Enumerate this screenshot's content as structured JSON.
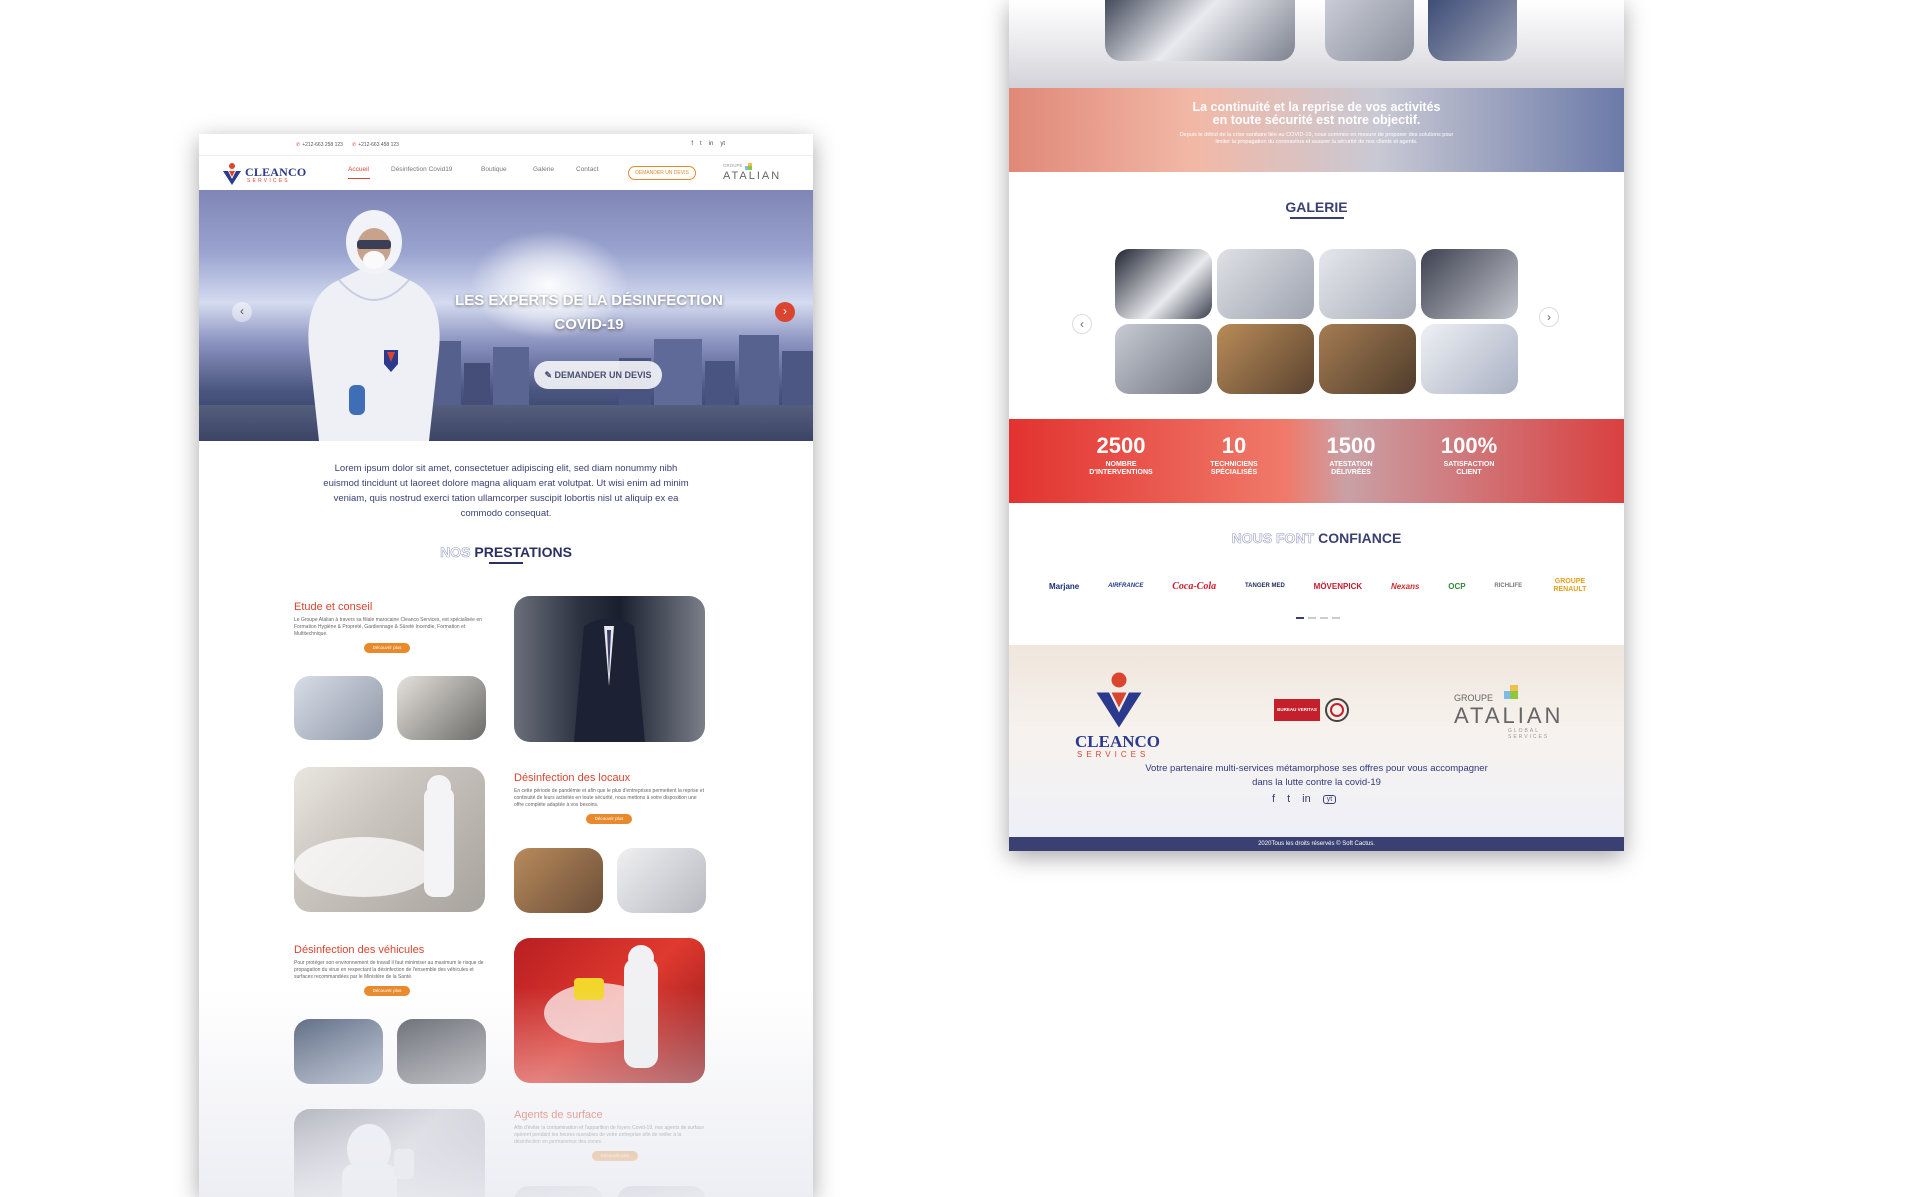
{
  "left": {
    "topbar": {
      "phone1": "+212-663 258 123",
      "phone2": "+212-663 458 123",
      "social": [
        "f",
        "t",
        "in",
        "yt"
      ]
    },
    "brand": {
      "name": "CLEANCO",
      "sub": "SERVICES"
    },
    "menu": [
      {
        "label": "Accueil",
        "active": true
      },
      {
        "label": "Désinfection Covid19",
        "active": false
      },
      {
        "label": "Boutique",
        "active": false
      },
      {
        "label": "Galerie",
        "active": false
      },
      {
        "label": "Contact",
        "active": false
      }
    ],
    "devis_button": "DEMANDER UN DEVIS",
    "partner": {
      "group": "GROUPE",
      "name": "ATALIAN"
    },
    "hero": {
      "title_line1": "LES EXPERTS DE LA DÉSINFECTION",
      "title_line2": "COVID-19",
      "button": "DEMANDER UN DEVIS",
      "prev": "‹",
      "next": "›"
    },
    "intro": "Lorem ipsum dolor sit amet, consectetuer adipiscing elit, sed diam nonummy nibh euismod tincidunt ut laoreet dolore magna aliquam erat volutpat. Ut wisi enim ad minim veniam, quis nostrud exerci tation ullamcorper suscipit lobortis nisl ut aliquip ex ea commodo consequat.",
    "section": {
      "ghost": "NOS",
      "title": "PRESTATIONS"
    },
    "services": [
      {
        "title": "Etude et conseil",
        "text": "Le Groupe Atalian à travers sa filiale marocaine Cleanco Services, est spécialisée en Formation Hygiène & Propreté, Gardiennage & Sûreté Incendie, Formation et Multitechnique.",
        "button": "Découvrir plus"
      },
      {
        "title": "Désinfection des locaux",
        "text": "En cette période de pandémie et afin que le plus d'entreprises permettent la reprise et continuité de leurs activités en toute sécurité, nous mettons à votre disposition une offre complète adaptée à vos besoins.",
        "button": "Découvrir plus"
      },
      {
        "title": "Désinfection des véhicules",
        "text": "Pour protéger son environnement de travail il faut minimiser au maximum le risque de propagation du virus en respectant la désinfection de l'ensemble des véhicules et surfaces recommandées par le Ministère de la Santé.",
        "button": "Découvrir plus"
      },
      {
        "title": "Agents de surface",
        "text": "Afin d'éviter la contamination et l'apparition de foyers Covid-19, nos agents de surface opèrent pendant les heures ouvrables de votre entreprise afin de veiller à la désinfection en permanence des zones.",
        "button": "Découvrir plus"
      }
    ]
  },
  "right": {
    "banner": {
      "title_line1": "La continuité et la reprise de vos activités",
      "title_line2": "en toute sécurité est notre objectif.",
      "text": "Depuis le début de la crise sanitaire liée au COVID-19, nous sommes en mesure de proposer des solutions pour limiter la propagation du coronavirus et assurer la sécurité de nos clients et agents."
    },
    "galerie": {
      "title": "GALERIE",
      "prev": "‹",
      "next": "›"
    },
    "stats": [
      {
        "value": "2500",
        "label_line1": "NOMBRE",
        "label_line2": "D'INTERVENTIONS"
      },
      {
        "value": "10",
        "label_line1": "TECHNICIENS",
        "label_line2": "SPÉCIALISÉS"
      },
      {
        "value": "1500",
        "label_line1": "ATESTATION",
        "label_line2": "DÉLIVRÉES"
      },
      {
        "value": "100%",
        "label_line1": "SATISFACTION",
        "label_line2": "CLIENT"
      }
    ],
    "confiance": {
      "ghost": "NOUS FONT",
      "title": "CONFIANCE"
    },
    "clients": [
      "Marjane",
      "AIRFRANCE",
      "Coca-Cola",
      "TANGER MED",
      "MÖVENPICK",
      "Nexans",
      "OCP",
      "RICHLIFE",
      "GROUPE RENAULT"
    ],
    "footer": {
      "brand": "CLEANCO",
      "brand_sub": "SERVICES",
      "cert": "BUREAU VERITAS",
      "partner_group": "GROUPE",
      "partner_name": "ATALIAN",
      "partner_sub": "GLOBAL SERVICES",
      "tagline": "Votre partenaire multi-services métamorphose ses offres pour vous accompagner dans la lutte contre la covid-19",
      "social": [
        "f",
        "t",
        "in",
        "yt"
      ],
      "copyright": "2020Tous les droits réservés © Soft Cactus."
    }
  },
  "colors": {
    "brand_blue": "#2b3a8c",
    "accent_red": "#d9452f",
    "accent_orange": "#e8892b",
    "navy": "#3a4172"
  }
}
